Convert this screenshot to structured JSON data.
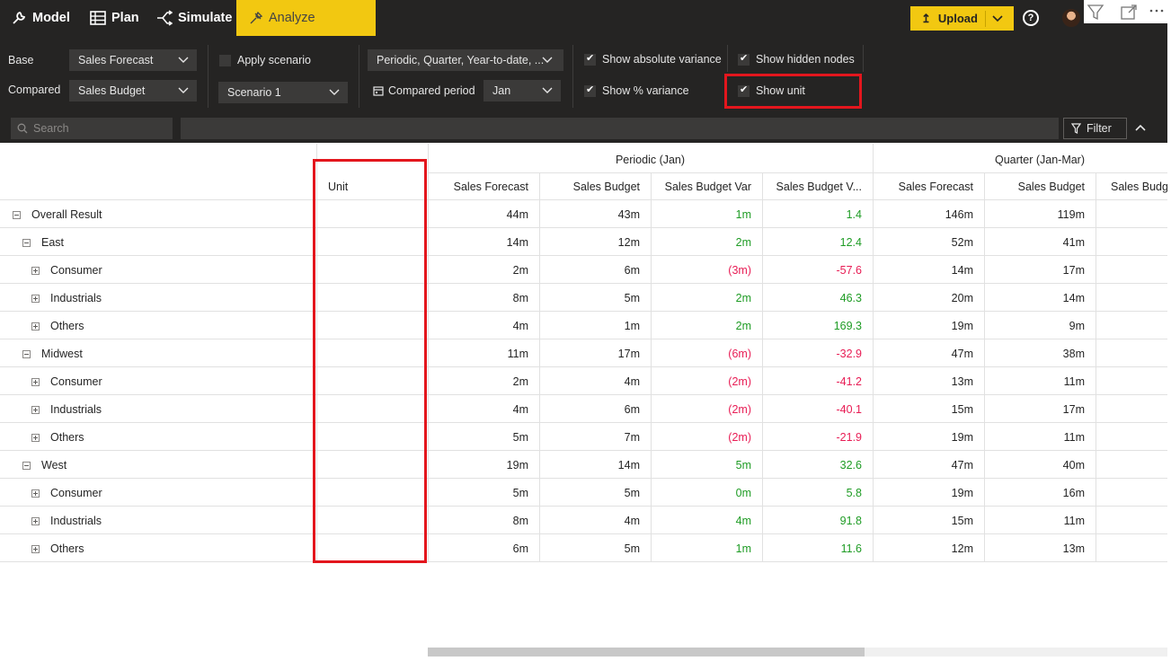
{
  "nav": {
    "model": "Model",
    "plan": "Plan",
    "simulate": "Simulate",
    "analyze": "Analyze",
    "upload": "Upload",
    "help": "?"
  },
  "toolbar": {
    "base_label": "Base",
    "base_value": "Sales Forecast",
    "compared_label": "Compared",
    "compared_value": "Sales Budget",
    "apply_scenario": "Apply scenario",
    "scenario_value": "Scenario 1",
    "periods_value": "Periodic, Quarter, Year-to-date, ...",
    "compared_period_label": "Compared period",
    "compared_period_value": "Jan",
    "show_absolute_variance": "Show absolute variance",
    "show_pct_variance": "Show % variance",
    "show_hidden_nodes": "Show hidden nodes",
    "show_unit": "Show unit"
  },
  "search": {
    "placeholder": "Search",
    "filter_label": "Filter"
  },
  "grid": {
    "groups": [
      "Periodic (Jan)",
      "Quarter (Jan-Mar)"
    ],
    "unit_header": "Unit",
    "columns": [
      "Sales Forecast",
      "Sales Budget",
      "Sales Budget Var",
      "Sales Budget V...",
      "Sales Forecast",
      "Sales Budget",
      "Sales Budge"
    ],
    "rows": [
      {
        "label": "Overall Result",
        "level": 0,
        "expander": "minus",
        "values": [
          "44m",
          "43m",
          "1m",
          "1.4",
          "146m",
          "119m",
          ""
        ],
        "signs": [
          "",
          "",
          "pos",
          "pos",
          "",
          "",
          ""
        ]
      },
      {
        "label": "East",
        "level": 1,
        "expander": "minus",
        "values": [
          "14m",
          "12m",
          "2m",
          "12.4",
          "52m",
          "41m",
          ""
        ],
        "signs": [
          "",
          "",
          "pos",
          "pos",
          "",
          "",
          ""
        ]
      },
      {
        "label": "Consumer",
        "level": 2,
        "expander": "plus",
        "values": [
          "2m",
          "6m",
          "(3m)",
          "-57.6",
          "14m",
          "17m",
          ""
        ],
        "signs": [
          "",
          "",
          "neg",
          "neg",
          "",
          "",
          ""
        ]
      },
      {
        "label": "Industrials",
        "level": 2,
        "expander": "plus",
        "values": [
          "8m",
          "5m",
          "2m",
          "46.3",
          "20m",
          "14m",
          ""
        ],
        "signs": [
          "",
          "",
          "pos",
          "pos",
          "",
          "",
          ""
        ]
      },
      {
        "label": "Others",
        "level": 2,
        "expander": "plus",
        "values": [
          "4m",
          "1m",
          "2m",
          "169.3",
          "19m",
          "9m",
          ""
        ],
        "signs": [
          "",
          "",
          "pos",
          "pos",
          "",
          "",
          ""
        ]
      },
      {
        "label": "Midwest",
        "level": 1,
        "expander": "minus",
        "values": [
          "11m",
          "17m",
          "(6m)",
          "-32.9",
          "47m",
          "38m",
          ""
        ],
        "signs": [
          "",
          "",
          "neg",
          "neg",
          "",
          "",
          ""
        ]
      },
      {
        "label": "Consumer",
        "level": 2,
        "expander": "plus",
        "values": [
          "2m",
          "4m",
          "(2m)",
          "-41.2",
          "13m",
          "11m",
          ""
        ],
        "signs": [
          "",
          "",
          "neg",
          "neg",
          "",
          "",
          ""
        ]
      },
      {
        "label": "Industrials",
        "level": 2,
        "expander": "plus",
        "values": [
          "4m",
          "6m",
          "(2m)",
          "-40.1",
          "15m",
          "17m",
          ""
        ],
        "signs": [
          "",
          "",
          "neg",
          "neg",
          "",
          "",
          ""
        ]
      },
      {
        "label": "Others",
        "level": 2,
        "expander": "plus",
        "values": [
          "5m",
          "7m",
          "(2m)",
          "-21.9",
          "19m",
          "11m",
          ""
        ],
        "signs": [
          "",
          "",
          "neg",
          "neg",
          "",
          "",
          ""
        ]
      },
      {
        "label": "West",
        "level": 1,
        "expander": "minus",
        "values": [
          "19m",
          "14m",
          "5m",
          "32.6",
          "47m",
          "40m",
          ""
        ],
        "signs": [
          "",
          "",
          "pos",
          "pos",
          "",
          "",
          ""
        ]
      },
      {
        "label": "Consumer",
        "level": 2,
        "expander": "plus",
        "values": [
          "5m",
          "5m",
          "0m",
          "5.8",
          "19m",
          "16m",
          ""
        ],
        "signs": [
          "",
          "",
          "pos",
          "pos",
          "",
          "",
          ""
        ]
      },
      {
        "label": "Industrials",
        "level": 2,
        "expander": "plus",
        "values": [
          "8m",
          "4m",
          "4m",
          "91.8",
          "15m",
          "11m",
          ""
        ],
        "signs": [
          "",
          "",
          "pos",
          "pos",
          "",
          "",
          ""
        ]
      },
      {
        "label": "Others",
        "level": 2,
        "expander": "plus",
        "values": [
          "6m",
          "5m",
          "1m",
          "11.6",
          "12m",
          "13m",
          ""
        ],
        "signs": [
          "",
          "",
          "pos",
          "pos",
          "",
          "",
          ""
        ]
      }
    ]
  },
  "colors": {
    "accent": "#f2c811",
    "positive": "#1f9c25",
    "negative": "#e81d55",
    "highlight": "#e3161d",
    "toolbar_bg": "#252423"
  },
  "icons": [
    "model-icon",
    "plan-icon",
    "simulate-icon",
    "analyze-icon",
    "upload-icon",
    "chevron-down-icon",
    "help-icon",
    "avatar",
    "filter-funnel-icon",
    "expand-icon",
    "more-icon",
    "calendar-icon",
    "search-icon",
    "filter-icon",
    "chevron-up-icon"
  ]
}
